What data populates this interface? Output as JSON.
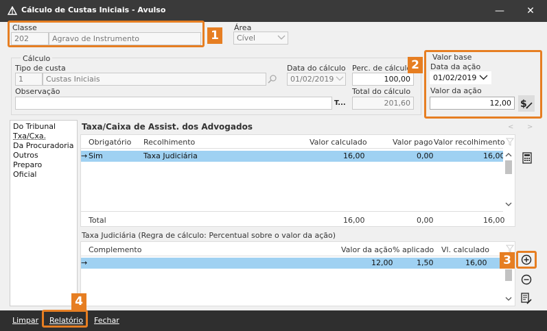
{
  "window": {
    "title": "Cálculo de Custas Iniciais - Avulso",
    "minimize_glyph": "—",
    "close_glyph": "✕"
  },
  "classe": {
    "label": "Classe",
    "code": "202",
    "name": "Agravo de Instrumento"
  },
  "area": {
    "label": "Área",
    "value": "Cível"
  },
  "calculo": {
    "group_label": "Cálculo",
    "tipo_custa_label": "Tipo de custa",
    "tipo_custa_code": "1",
    "tipo_custa_name": "Custas Iniciais",
    "data_calculo_label": "Data do cálculo",
    "data_calculo_value": "01/02/2019",
    "perc_label": "Perc. de cálculo",
    "perc_value": "100,00",
    "observacao_label": "Observação",
    "observacao_value": "",
    "text_btn_label": "T...",
    "total_label": "Total do cálculo",
    "total_value": "201,60"
  },
  "valor_base": {
    "group_label": "Valor base",
    "data_acao_label": "Data da ação",
    "data_acao_value": "01/02/2019",
    "valor_acao_label": "Valor da ação",
    "valor_acao_value": "12,00"
  },
  "badges": [
    "1",
    "2",
    "3",
    "4"
  ],
  "side_list": [
    "Do Tribunal",
    "Txa/Cxa.",
    "Da Procuradoria",
    "Outros",
    "Preparo",
    "Oficial"
  ],
  "panel": {
    "title": "Taxa/Caixa de Assist. dos Advogados",
    "nav_prev": "<",
    "nav_next": ">",
    "grid1": {
      "headers": [
        "Obrigatório",
        "Recolhimento",
        "Valor calculado",
        "Valor pago",
        "Valor recolhimento"
      ],
      "row": {
        "arrow": "→",
        "obrigatorio": "Sim",
        "recolhimento": "Taxa Judiciária",
        "valor_calculado": "16,00",
        "valor_pago": "0,00",
        "valor_recolhimento": "16,00"
      },
      "total": {
        "label": "Total",
        "valor_calculado": "16,00",
        "valor_pago": "0,00",
        "valor_recolhimento": "16,00"
      }
    },
    "regra_label": "Taxa Judiciária (Regra de cálculo: Percentual sobre o valor da ação)",
    "grid2": {
      "headers": [
        "Complemento",
        "Valor da ação",
        "% aplicado",
        "Vl. calculado"
      ],
      "row": {
        "arrow": "→",
        "complemento": "",
        "valor_acao": "12,00",
        "perc_aplicado": "1,50",
        "vl_calculado": "16,00"
      }
    }
  },
  "footer": {
    "limpar": "Limpar",
    "relatorio": "Relatório",
    "fechar": "Fechar"
  },
  "colors": {
    "accent": "#e67e22",
    "selection": "#9fd1f2",
    "titlebar": "#3a3a3a",
    "footer": "#2f2f2f"
  }
}
